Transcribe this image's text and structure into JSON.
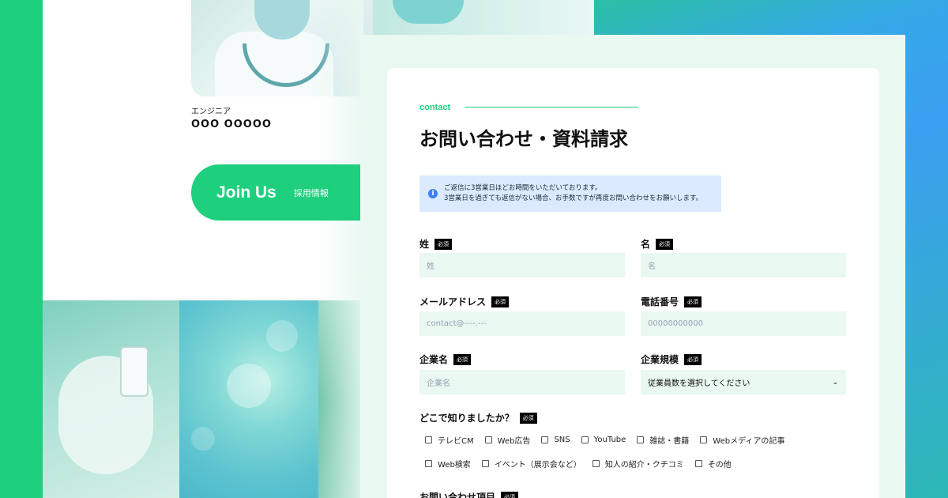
{
  "staff": {
    "role": "エンジニア",
    "name": "OOO OOOOO"
  },
  "join": {
    "title": "Join Us",
    "subtitle": "採用情報"
  },
  "form": {
    "eyebrow": "contact",
    "title": "お問い合わせ・資料請求",
    "notice_line1": "ご返信に3営業日ほどお時間をいただいております。",
    "notice_line2": "3営業日を過ぎても返信がない場合、お手数ですが再度お問い合わせをお願いします。",
    "notice_icon": "info-icon",
    "required_badge": "必須",
    "fields": {
      "last_name": {
        "label": "姓",
        "placeholder": "姓"
      },
      "first_name": {
        "label": "名",
        "placeholder": "名"
      },
      "email": {
        "label": "メールアドレス",
        "placeholder": "contact@----.---"
      },
      "phone": {
        "label": "電話番号",
        "placeholder": "00000000000"
      },
      "company": {
        "label": "企業名",
        "placeholder": "企業名"
      },
      "company_size": {
        "label": "企業規模",
        "selected": "従業員数を選択してください"
      }
    },
    "source_question": "どこで知りましたか？",
    "source_options_row1": [
      "テレビCM",
      "Web広告",
      "SNS",
      "YouTube",
      "雑誌・書籍",
      "Webメディアの記事"
    ],
    "source_options_row2": [
      "Web検索",
      "イベント（展示会など）",
      "知人の紹介・クチコミ",
      "その他"
    ],
    "inquiry_label": "お問い合わせ項目"
  },
  "colors": {
    "brand_green": "#1ecf7e",
    "input_bg": "#e9f8f0",
    "notice_bg": "#dbeafe"
  }
}
